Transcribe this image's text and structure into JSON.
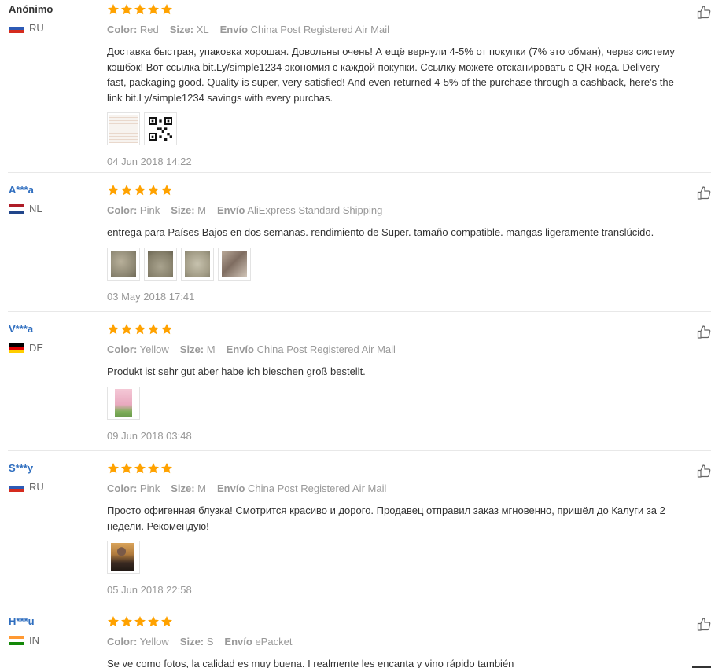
{
  "labels": {
    "color": "Color:",
    "size": "Size:",
    "shipping": "Envío"
  },
  "colors": {
    "star": "#ffa200",
    "link_user": "#2f6ebf",
    "muted": "#999999",
    "text": "#333333"
  },
  "reviews": [
    {
      "user": "Anónimo",
      "country": "RU",
      "rating": 5,
      "color": "Red",
      "size": "XL",
      "shipping": "China Post Registered Air Mail",
      "text": "Доставка быстрая, упаковка хорошая. Довольны очень! А ещё вернули 4-5% от покупки (7% это обман), через систему кэшбэк! Вот ссылка bit.Ly/simple1234 экономия с каждой покупки. Ссылку можете отсканировать с QR-кода. Delivery fast, packaging good. Quality is super, very satisfied! And even returned 4-5% of the purchase through a cashback, here's the link bit.Ly/simple1234 savings with every purchas.",
      "date": "04 Jun 2018 14:22"
    },
    {
      "user": "A***a",
      "country": "NL",
      "rating": 5,
      "color": "Pink",
      "size": "M",
      "shipping": "AliExpress Standard Shipping",
      "text": "entrega para Países Bajos en dos semanas. rendimiento de Super. tamaño compatible. mangas ligeramente translúcido.",
      "date": "03 May 2018 17:41"
    },
    {
      "user": "V***a",
      "country": "DE",
      "rating": 5,
      "color": "Yellow",
      "size": "M",
      "shipping": "China Post Registered Air Mail",
      "text": "Produkt ist sehr gut aber habe ich bieschen groß bestellt.",
      "date": "09 Jun 2018 03:48"
    },
    {
      "user": "S***y",
      "country": "RU",
      "rating": 5,
      "color": "Pink",
      "size": "M",
      "shipping": "China Post Registered Air Mail",
      "text": "Просто офигенная блузка! Смотрится красиво и дорого. Продавец отправил заказ мгновенно, пришёл до Калуги за 2 недели. Рекомендую!",
      "date": "05 Jun 2018 22:58"
    },
    {
      "user": "H***u",
      "country": "IN",
      "rating": 5,
      "color": "Yellow",
      "size": "S",
      "shipping": "ePacket",
      "text": "Se ve como fotos, la calidad es muy buena. I realmente les encanta y vino rápido también",
      "date": ""
    }
  ]
}
